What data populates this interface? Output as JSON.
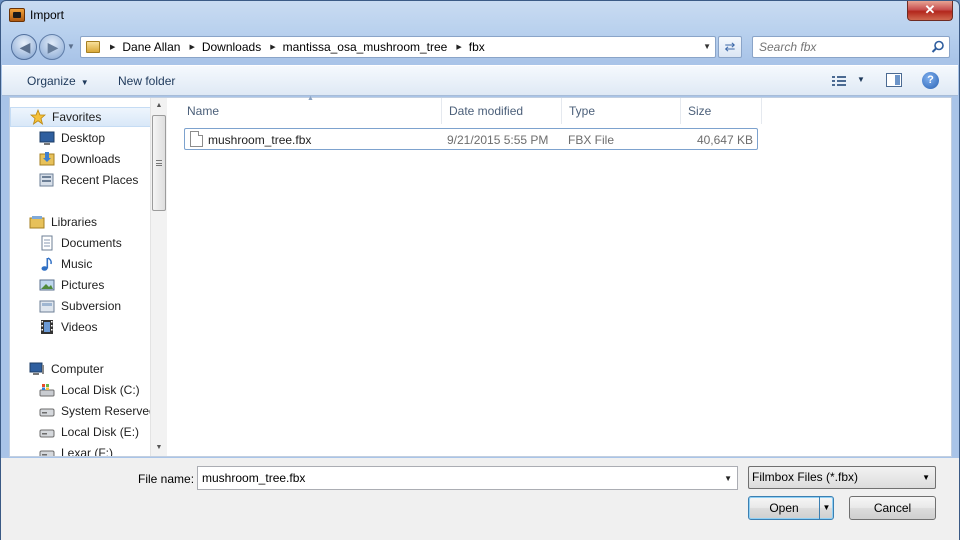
{
  "window": {
    "title": "Import",
    "close_glyph": "✕"
  },
  "nav": {
    "breadcrumbs": [
      "Dane Allan",
      "Downloads",
      "mantissa_osa_mushroom_tree",
      "fbx"
    ],
    "search_placeholder": "Search fbx"
  },
  "toolbar": {
    "organize": "Organize",
    "new_folder": "New folder",
    "help": "?"
  },
  "sidebar": {
    "favorites": {
      "label": "Favorites",
      "items": [
        "Desktop",
        "Downloads",
        "Recent Places"
      ]
    },
    "libraries": {
      "label": "Libraries",
      "items": [
        "Documents",
        "Music",
        "Pictures",
        "Subversion",
        "Videos"
      ]
    },
    "computer": {
      "label": "Computer",
      "items": [
        "Local Disk (C:)",
        "System Reserved",
        "Local Disk (E:)",
        "Lexar (F:)"
      ]
    }
  },
  "columns": {
    "name": "Name",
    "date": "Date modified",
    "type": "Type",
    "size": "Size"
  },
  "files": [
    {
      "name": "mushroom_tree.fbx",
      "date": "9/21/2015 5:55 PM",
      "type": "FBX File",
      "size": "40,647 KB"
    }
  ],
  "footer": {
    "file_name_label": "File name:",
    "file_name_value": "mushroom_tree.fbx",
    "file_type": "Filmbox Files (*.fbx)",
    "open": "Open",
    "cancel": "Cancel"
  },
  "colors": {
    "accent": "#3c7fb1",
    "frame": "#a9c4e8",
    "selection": "#d9e8f8"
  }
}
